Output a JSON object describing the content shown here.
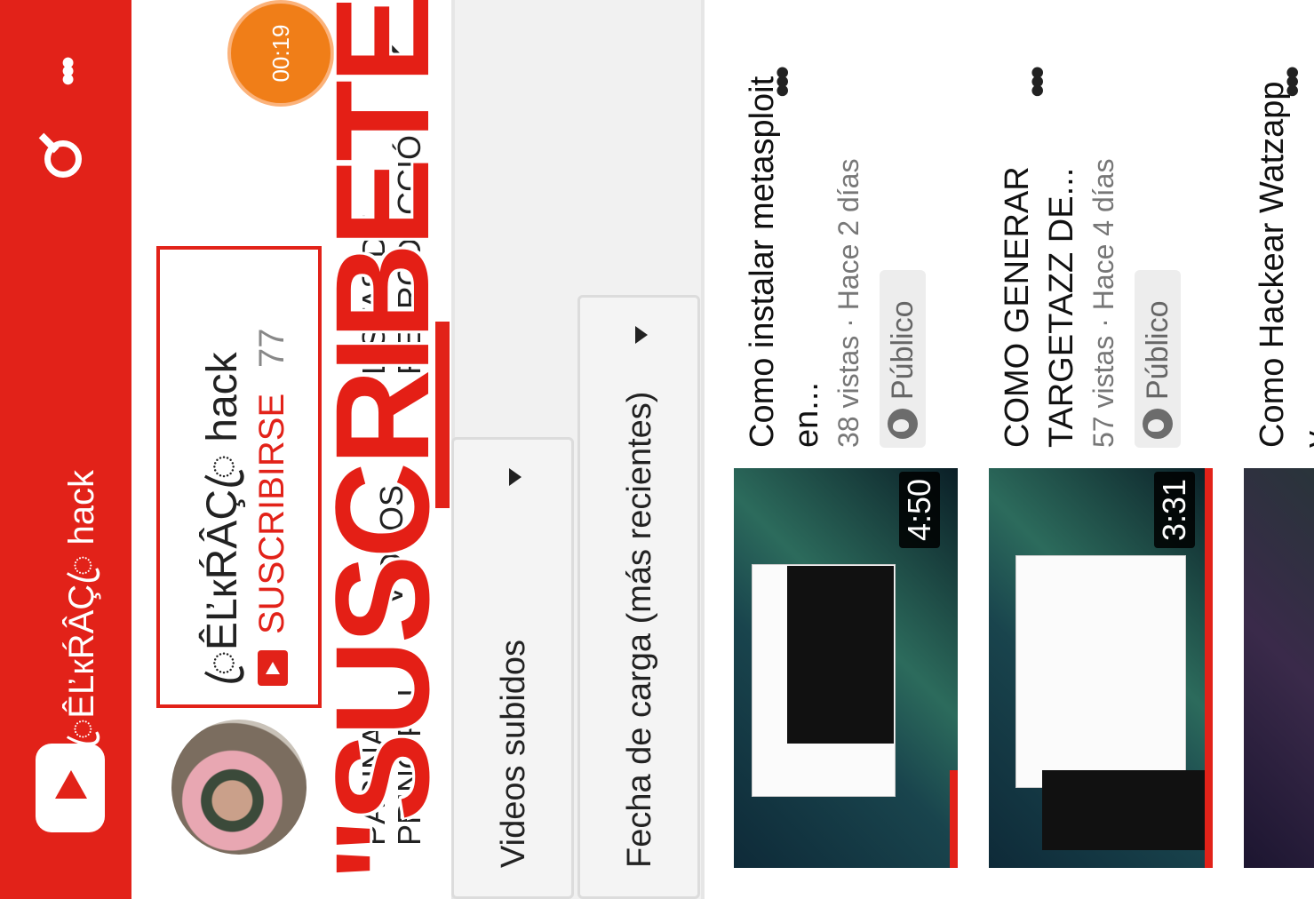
{
  "app": {
    "title": "ꦿÊĽкŔÂÇꦿ hack",
    "search_icon": "search-icon",
    "more_icon": "more-vert-icon",
    "more_glyph": "•••",
    "accent": "#e22219"
  },
  "channel": {
    "name": "ꦿÊĽкŔÂÇꦿ hack",
    "subscribe_label": "SUSCRIBIRSE",
    "subscriber_count": "77",
    "timer": "00:19"
  },
  "tabs": [
    {
      "line1": "PÁGINA",
      "line2": "PRINCIPAL"
    },
    {
      "line1": "VIDEOS",
      "line2": ""
    },
    {
      "line1": "LISTAS DE",
      "line2": "REPRODUCCIÓN"
    }
  ],
  "overlay": {
    "text": "\"SUSCRIBETE\""
  },
  "filters": {
    "type": "Videos subidos",
    "sort": "Fecha de carga (más recientes)"
  },
  "videos": [
    {
      "title": "Como instalar metasploit en...",
      "views": "38 vistas",
      "age": "Hace 2 días",
      "meta": "38 vistas · Hace 2 días",
      "visibility": "Público",
      "duration": "4:50"
    },
    {
      "title": "COMO GENERAR TARGETAZZ DE...",
      "views": "57 vistas",
      "age": "Hace 4 días",
      "meta": "57 vistas · Hace 4 días",
      "visibility": "Público",
      "duration": "3:31"
    },
    {
      "title": "Como Hackear Watzapp y...",
      "views": "",
      "age": "",
      "meta": "",
      "visibility": "",
      "duration": ""
    }
  ]
}
